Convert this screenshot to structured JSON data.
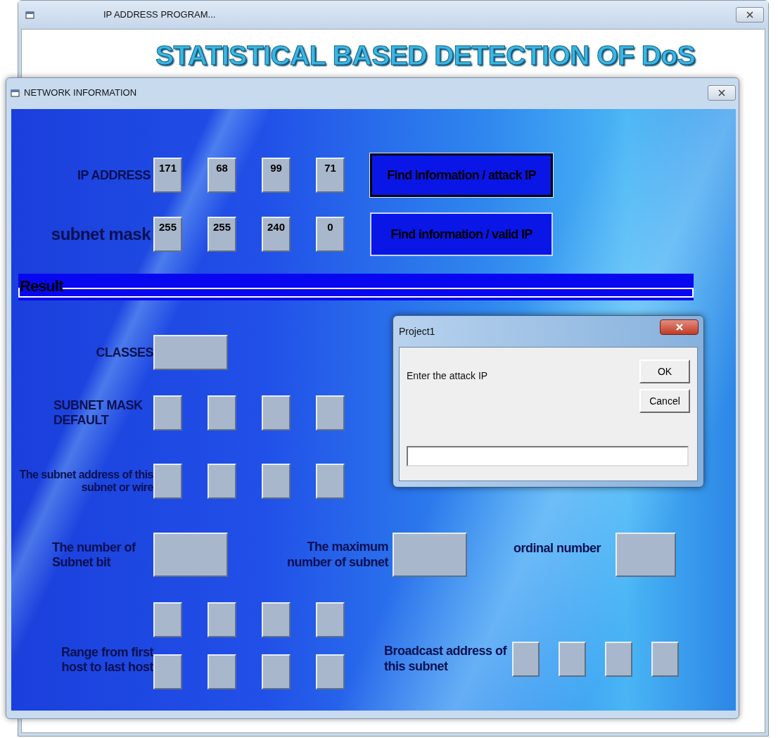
{
  "main_window": {
    "title": "IP ADDRESS PROGRAM...",
    "banner": "STATISTICAL BASED DETECTION OF DoS"
  },
  "network_window": {
    "title": "NETWORK INFORMATION",
    "ip_address": {
      "label": "IP ADDRESS",
      "octets": [
        "171",
        "68",
        "99",
        "71"
      ]
    },
    "subnet_mask": {
      "label": "subnet mask",
      "octets": [
        "255",
        "255",
        "240",
        "0"
      ]
    },
    "buttons": [
      {
        "label": "Find information / attack IP",
        "focused": true
      },
      {
        "label": "Find information / valid IP",
        "focused": false
      }
    ],
    "result_heading": "Result",
    "classes_label": "CLASSES",
    "default_mask_label": "SUBNET MASK DEFAULT",
    "subnet_address_label": "The subnet address of this subnet or wire",
    "subnet_bits_label": "The number of Subnet bit",
    "max_subnets_label": "The maximum number of subnet",
    "ordinal_label": "ordinal number",
    "range_label": "Range from first host to last host",
    "broadcast_label": "Broadcast address of this subnet"
  },
  "dialog": {
    "title": "Project1",
    "prompt": "Enter the attack IP",
    "buttons": [
      "OK",
      "Cancel"
    ]
  }
}
